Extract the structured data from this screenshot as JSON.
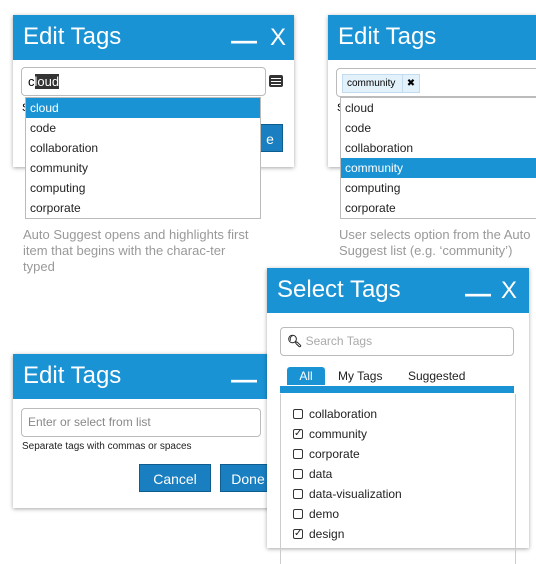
{
  "panel1": {
    "title": "Edit Tags",
    "minimize": "—",
    "close": "X",
    "input_prefix": "c",
    "input_selected": "loud",
    "list_icon": "list-icon",
    "options": [
      "cloud",
      "code",
      "collaboration",
      "community",
      "computing",
      "corporate"
    ],
    "selected_index": 0,
    "hidden_hint": "S",
    "hidden_button_tail": "e",
    "caption": "Auto Suggest opens and highlights first item that begins with the charac-ter typed"
  },
  "panel2": {
    "title": "Edit Tags",
    "token": "community",
    "token_remove": "✖",
    "options": [
      "cloud",
      "code",
      "collaboration",
      "community",
      "computing",
      "corporate"
    ],
    "selected_index": 3,
    "hidden_hint": "S",
    "caption": "User selects option from the Auto Suggest list (e.g. ‘community’)"
  },
  "panel3": {
    "title": "Edit Tags",
    "minimize": "—",
    "placeholder": "Enter or select from list",
    "hint": "Separate tags with commas or spaces",
    "cancel": "Cancel",
    "done": "Done"
  },
  "panel4": {
    "title": "Select Tags",
    "minimize": "—",
    "close": "X",
    "search_placeholder": "Search Tags",
    "tabs": [
      "All",
      "My Tags",
      "Suggested"
    ],
    "active_tab": 0,
    "items": [
      {
        "label": "collaboration",
        "checked": false
      },
      {
        "label": "community",
        "checked": true
      },
      {
        "label": "corporate",
        "checked": false
      },
      {
        "label": "data",
        "checked": false
      },
      {
        "label": "data-visualization",
        "checked": false
      },
      {
        "label": "demo",
        "checked": false
      },
      {
        "label": "design",
        "checked": true
      }
    ]
  },
  "colors": {
    "accent": "#1a93d5",
    "button": "#1a7fc0"
  }
}
